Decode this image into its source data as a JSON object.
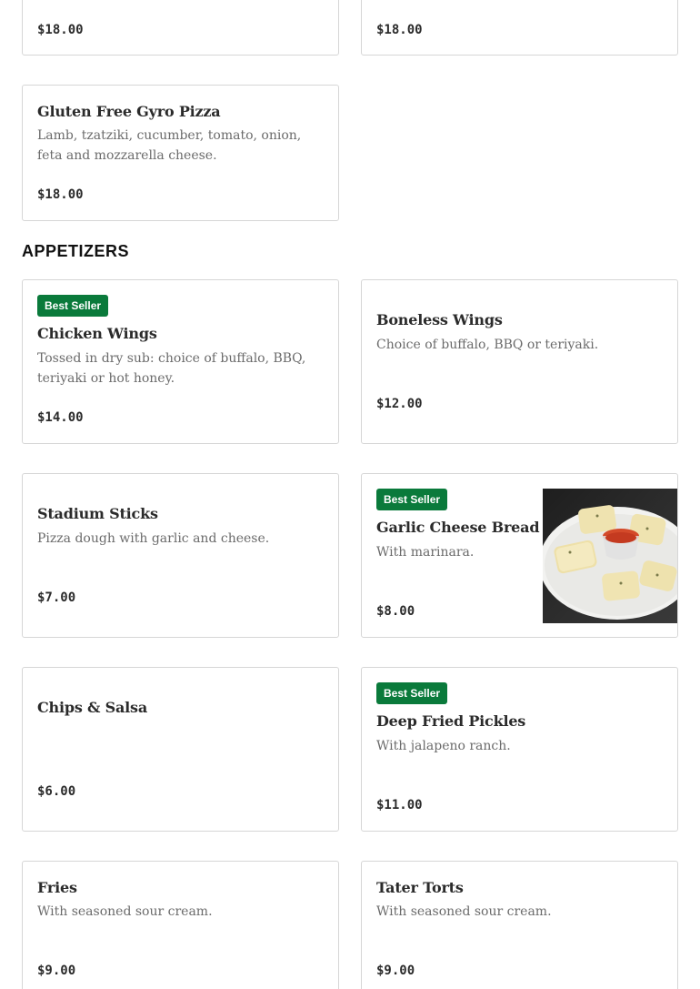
{
  "top_cards": {
    "left_price": "$18.00",
    "right_price": "$18.00"
  },
  "gluten_free_gyro": {
    "name": "Gluten Free Gyro Pizza",
    "desc": "Lamb, tzatziki, cucumber, tomato, onion, feta and mozzarella cheese.",
    "price": "$18.00"
  },
  "section": {
    "title": "APPETIZERS"
  },
  "badge_label": "Best Seller",
  "items": {
    "chicken_wings": {
      "name": "Chicken Wings",
      "desc": "Tossed in dry sub: choice of buffalo, BBQ, teriyaki or hot honey.",
      "price": "$14.00"
    },
    "boneless_wings": {
      "name": "Boneless Wings",
      "desc": "Choice of buffalo, BBQ or teriyaki.",
      "price": "$12.00"
    },
    "stadium_sticks": {
      "name": "Stadium Sticks",
      "desc": "Pizza dough with garlic and cheese.",
      "price": "$7.00"
    },
    "garlic_cheese_bread": {
      "name": "Garlic Cheese Bread",
      "desc": "With marinara.",
      "price": "$8.00"
    },
    "chips_salsa": {
      "name": "Chips & Salsa",
      "price": "$6.00"
    },
    "deep_fried_pickles": {
      "name": "Deep Fried Pickles",
      "desc": "With jalapeno ranch.",
      "price": "$11.00"
    },
    "fries": {
      "name": "Fries",
      "desc": "With seasoned sour cream.",
      "price": "$9.00"
    },
    "tater_torts": {
      "name": "Tater Torts",
      "desc": "With seasoned sour cream.",
      "price": "$9.00"
    }
  },
  "colors": {
    "badge_bg": "#0a7a3b",
    "card_border": "#d6d6d6",
    "desc_text": "#6b6b6b"
  }
}
